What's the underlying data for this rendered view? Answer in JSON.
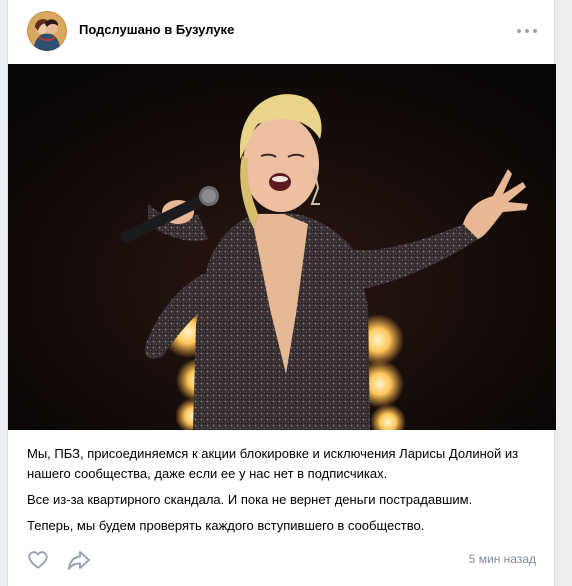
{
  "post": {
    "group_name": "Подслушано в Бузулуке",
    "menu_icon": "more-horizontal-icon",
    "paragraphs": [
      "Мы, ПБЗ, присоединяемся к акции блокировке и исключения Ларисы Долиной из нашего сообщества, даже если ее у нас нет в подписчиках.",
      "Все из-за квартирного скандала. И пока не вернет деньги пострадавшим.",
      "Теперь, мы будем проверять каждого вступившего в сообщество."
    ],
    "timestamp": "5 мин назад",
    "actions": {
      "like_icon": "heart-icon",
      "share_icon": "share-arrow-icon"
    }
  },
  "colors": {
    "page_bg": "#edeef0",
    "card_bg": "#ffffff",
    "icon_gray": "#99a2ad",
    "meta_text": "#818c99"
  }
}
